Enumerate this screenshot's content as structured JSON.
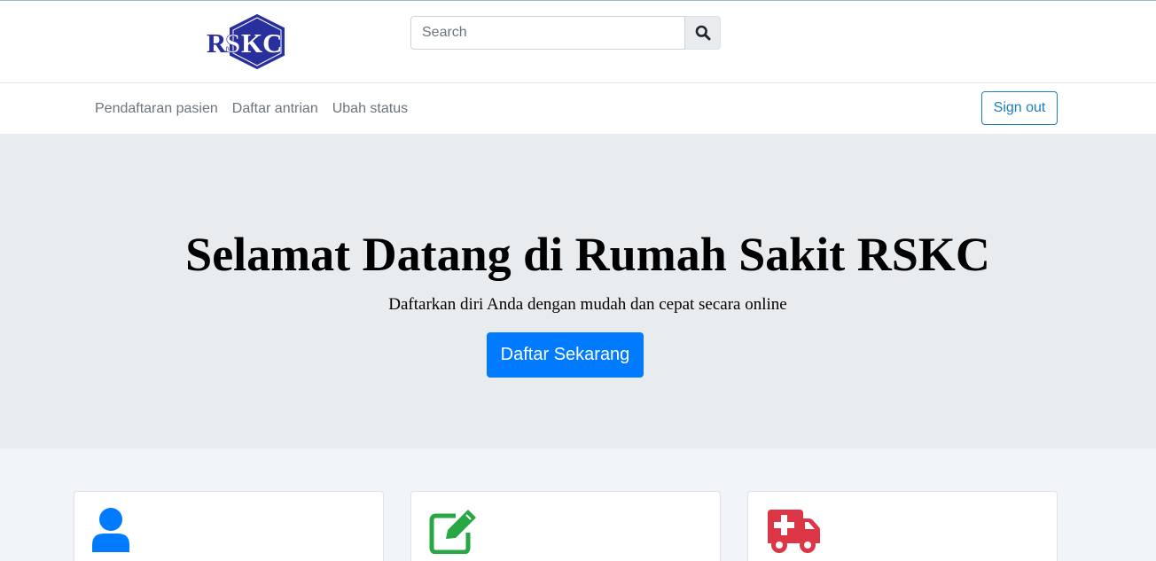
{
  "header": {
    "logo_text": "RSKC",
    "search": {
      "placeholder": "Search",
      "value": ""
    },
    "search_button_icon": "search-icon"
  },
  "nav": {
    "links": [
      {
        "label": "Pendaftaran pasien"
      },
      {
        "label": "Daftar antrian"
      },
      {
        "label": "Ubah status"
      }
    ],
    "signout_label": "Sign out"
  },
  "hero": {
    "title": "Selamat Datang di Rumah Sakit RSKC",
    "subtitle": "Daftarkan diri Anda dengan mudah dan cepat secara online",
    "cta_label": "Daftar Sekarang"
  },
  "cards": [
    {
      "icon": "user-icon",
      "color": "#007bff"
    },
    {
      "icon": "edit-icon",
      "color": "#28a745"
    },
    {
      "icon": "ambulance-icon",
      "color": "#dc3545"
    }
  ],
  "colors": {
    "primary": "#007bff",
    "brand_navy": "#2a2f9e",
    "outline_button": "#1b7fb8",
    "hero_bg": "#e9ecef",
    "page_bg": "#f1f4f8"
  }
}
